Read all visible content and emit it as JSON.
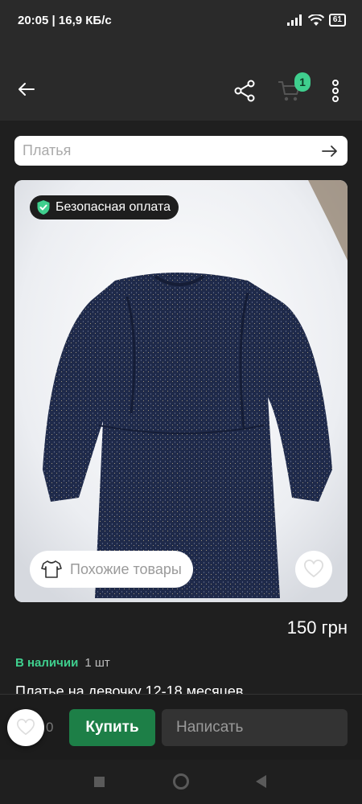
{
  "status_bar": {
    "time_speed": "20:05 | 16,9 КБ/с",
    "battery": "61"
  },
  "toolbar": {
    "cart_count": "1"
  },
  "search": {
    "placeholder": "Платья"
  },
  "product": {
    "safe_payment_label": "Безопасная оплата",
    "similar_label": "Похожие товары",
    "price": "150 грн",
    "stock_status": "В наличии",
    "stock_qty": "1 шт",
    "title": "Платье на девочку 12-18 месяцев"
  },
  "bottom_bar": {
    "like_count": "0",
    "buy_label": "Купить",
    "message_placeholder": "Написать"
  },
  "colors": {
    "accent_green": "#3fcf8e",
    "buy_button": "#1d7f47",
    "background": "#1f1f1f"
  },
  "icons": [
    "back-arrow-icon",
    "share-icon",
    "cart-icon",
    "more-vert-icon",
    "arrow-right-icon",
    "shield-check-icon",
    "tshirt-icon",
    "heart-icon",
    "send-icon"
  ]
}
